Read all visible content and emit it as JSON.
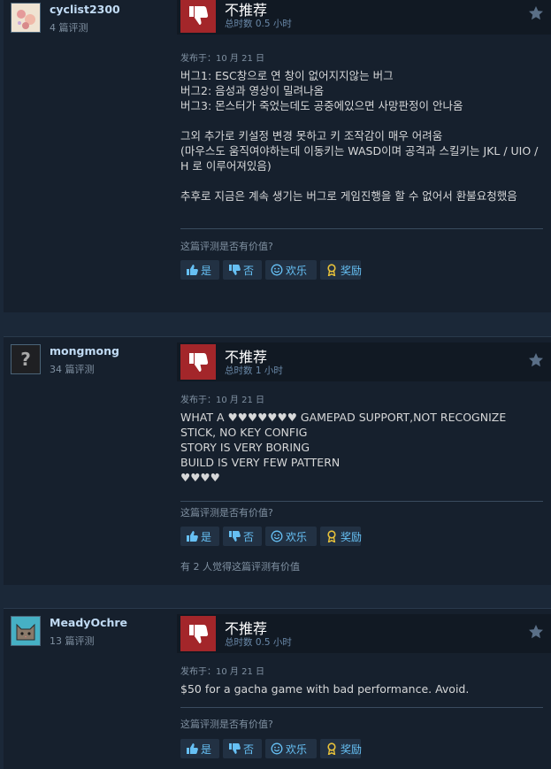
{
  "reviews": [
    {
      "author": "cyclist2300",
      "review_count": "4 篇评测",
      "verdict": "不推荐",
      "hours": "总时数 0.5 小时",
      "posted": "发布于：10 月 21 日",
      "body": "버그1: ESC창으로 연 창이 없어지지않는 버그\n버그2: 음성과 영상이 밀려나옴\n버그3: 몬스터가 죽었는데도 공중에있으면 사망판정이 안나옴\n\n그외 추가로 키설정 변경 못하고 키 조작감이 매우 어려움\n(마우스도 움직여야하는데 이동키는 WASD이며 공격과 스킬키는 JKL / UIO / H 로 이루어져있음)\n\n추후로 지금은 계속 생기는 버그로 게임진행을 할 수 없어서 환불요청했음",
      "helpful_question": "这篇评测是否有价值?",
      "buttons": {
        "yes": "是",
        "no": "否",
        "funny": "欢乐",
        "award": "奖励"
      },
      "found_helpful": ""
    },
    {
      "author": "mongmong",
      "review_count": "34 篇评测",
      "verdict": "不推荐",
      "hours": "总时数 1 小时",
      "posted": "发布于：10 月 21 日",
      "body": "WHAT A ♥♥♥♥♥♥♥ GAMEPAD SUPPORT,NOT RECOGNIZE\nSTICK, NO KEY CONFIG\nSTORY IS VERY BORING\nBUILD IS VERY FEW PATTERN\n♥♥♥♥",
      "helpful_question": "这篇评测是否有价值?",
      "buttons": {
        "yes": "是",
        "no": "否",
        "funny": "欢乐",
        "award": "奖励"
      },
      "found_helpful": "有 2 人觉得这篇评测有价值"
    },
    {
      "author": "MeadyOchre",
      "review_count": "13 篇评测",
      "verdict": "不推荐",
      "hours": "总时数 0.5 小时",
      "posted": "发布于：10 月 21 日",
      "body": "$50 for a gacha game with bad performance. Avoid.",
      "helpful_question": "这篇评测是否有价值?",
      "buttons": {
        "yes": "是",
        "no": "否",
        "funny": "欢乐",
        "award": "奖励"
      },
      "found_helpful": ""
    }
  ],
  "colors": {
    "page_bg": "#1b2838",
    "card_bg": "#16202d",
    "not_recommended": "#a3262a",
    "link_blue": "#66c0f4",
    "award_gold": "#e8c23a"
  }
}
